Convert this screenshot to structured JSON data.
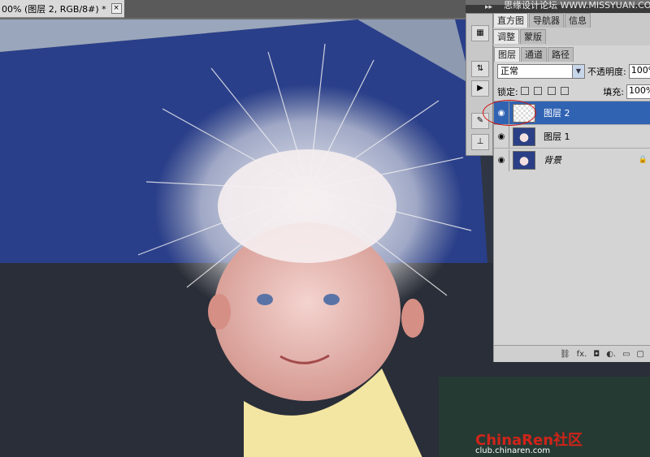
{
  "document": {
    "tab_title": "00% (图层 2, RGB/8#) *",
    "close_label": "×"
  },
  "panel": {
    "header_text": "思缘设计论坛 WWW.MISSYUAN.COM",
    "collapse_label": "▸▸"
  },
  "tool_icons": [
    "histogram-icon",
    "adjust-icon",
    "play-icon",
    "brush-icon",
    "stamp-icon"
  ],
  "top_tabs": [
    "直方图",
    "导航器",
    "信息"
  ],
  "adjust_tabs": [
    "调整",
    "蒙版"
  ],
  "layer_tabs": [
    "图层",
    "通道",
    "路径"
  ],
  "blend_mode": "正常",
  "opacity": {
    "label": "不透明度:",
    "value": "100%"
  },
  "lock": {
    "label": "锁定:"
  },
  "fill": {
    "label": "填充:",
    "value": "100%"
  },
  "layers": [
    {
      "name": "图层 2",
      "selected": true
    },
    {
      "name": "图层 1",
      "selected": false
    },
    {
      "name": "背景",
      "selected": false
    }
  ],
  "bottom_icons": [
    "link-icon",
    "fx-icon",
    "mask-icon",
    "adjustment-icon",
    "group-icon",
    "new-layer-icon"
  ],
  "bottom_labels": [
    "⛓",
    "fx.",
    "◘",
    "◐.",
    "▭",
    "▢"
  ],
  "watermark": {
    "text": "ChinaRen社区",
    "sub": "club.chinaren.com"
  },
  "colors": {
    "selection": "#3163b3",
    "annotation_circle": "#d01515",
    "tarp_blue": "#2a3f85"
  }
}
